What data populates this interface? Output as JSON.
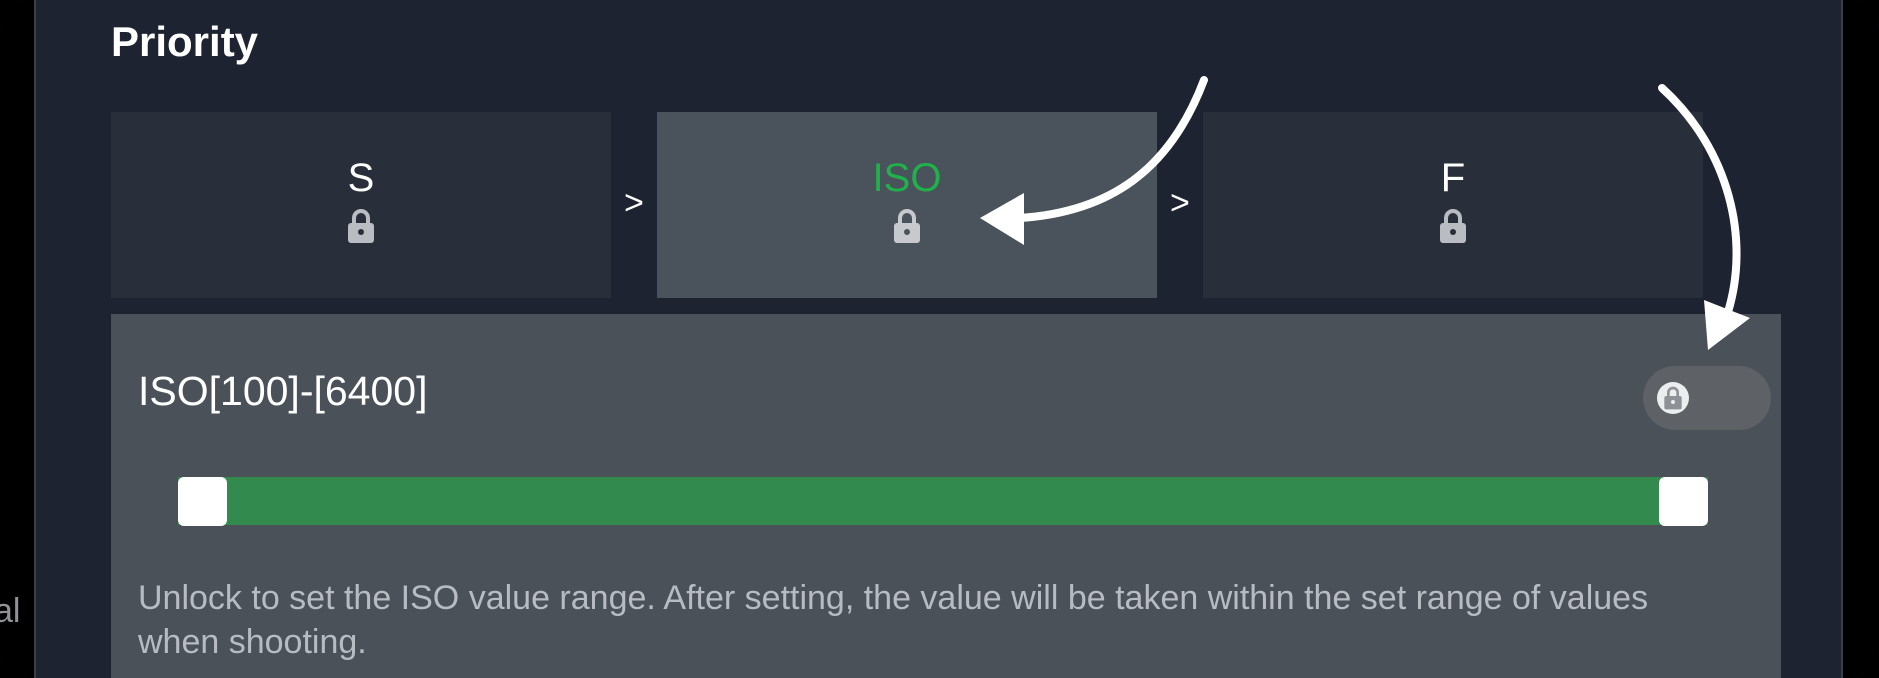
{
  "side_left_text": "al",
  "title": "Priority",
  "priority_items": [
    {
      "label": "S",
      "locked": true,
      "selected": false
    },
    {
      "label": "ISO",
      "locked": true,
      "selected": true
    },
    {
      "label": "F",
      "locked": true,
      "selected": false
    }
  ],
  "separators": [
    ">",
    ">"
  ],
  "range": {
    "title": "ISO[100]-[6400]",
    "min_value": 100,
    "max_value": 6400,
    "selected_low_fraction": 0.0,
    "selected_high_fraction": 1.0,
    "lock_toggle_on": false,
    "description": "Unlock to set the ISO value range. After setting, the value will be taken within the set range of values when shooting."
  },
  "colors": {
    "active_label": "#1fb24a",
    "slider_fill": "#338a4f",
    "background": "#1d2330",
    "panel": "#4a5159"
  }
}
